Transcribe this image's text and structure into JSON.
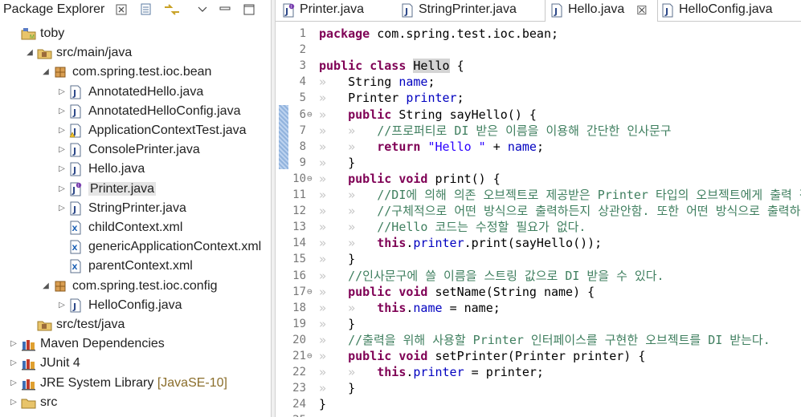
{
  "package_explorer": {
    "title": "Package Explorer",
    "header_icons": [
      "close-icon",
      "collapse-all-icon",
      "link-with-editor-icon",
      "view-menu-icon",
      "minimize-icon",
      "maximize-icon"
    ],
    "tree": [
      {
        "depth": 0,
        "twisty": "none",
        "icon": "project-icon",
        "label": "toby"
      },
      {
        "depth": 1,
        "twisty": "open",
        "icon": "source-folder-icon",
        "label": "src/main/java"
      },
      {
        "depth": 2,
        "twisty": "open",
        "icon": "package-icon",
        "label": "com.spring.test.ioc.bean"
      },
      {
        "depth": 3,
        "twisty": "closed",
        "icon": "java-file-icon",
        "label": "AnnotatedHello.java"
      },
      {
        "depth": 3,
        "twisty": "closed",
        "icon": "java-file-icon",
        "label": "AnnotatedHelloConfig.java"
      },
      {
        "depth": 3,
        "twisty": "closed",
        "icon": "java-file-warning-icon",
        "label": "ApplicationContextTest.java"
      },
      {
        "depth": 3,
        "twisty": "closed",
        "icon": "java-file-icon",
        "label": "ConsolePrinter.java"
      },
      {
        "depth": 3,
        "twisty": "closed",
        "icon": "java-file-icon",
        "label": "Hello.java"
      },
      {
        "depth": 3,
        "twisty": "closed",
        "icon": "java-interface-file-icon",
        "label": "Printer.java",
        "selected": true
      },
      {
        "depth": 3,
        "twisty": "closed",
        "icon": "java-file-icon",
        "label": "StringPrinter.java"
      },
      {
        "depth": 3,
        "twisty": "none",
        "icon": "xml-file-icon",
        "label": "childContext.xml"
      },
      {
        "depth": 3,
        "twisty": "none",
        "icon": "xml-file-icon",
        "label": "genericApplicationContext.xml"
      },
      {
        "depth": 3,
        "twisty": "none",
        "icon": "xml-file-icon",
        "label": "parentContext.xml"
      },
      {
        "depth": 2,
        "twisty": "open",
        "icon": "package-icon",
        "label": "com.spring.test.ioc.config"
      },
      {
        "depth": 3,
        "twisty": "closed",
        "icon": "java-file-icon",
        "label": "HelloConfig.java"
      },
      {
        "depth": 1,
        "twisty": "none",
        "icon": "source-folder-icon",
        "label": "src/test/java"
      },
      {
        "depth": 0,
        "twisty": "closed",
        "icon": "library-icon",
        "label": "Maven Dependencies"
      },
      {
        "depth": 0,
        "twisty": "closed",
        "icon": "library-icon",
        "label": "JUnit 4"
      },
      {
        "depth": 0,
        "twisty": "closed",
        "icon": "library-icon",
        "label": "JRE System Library",
        "decor": "[JavaSE-10]"
      },
      {
        "depth": 0,
        "twisty": "closed",
        "icon": "folder-icon",
        "label": "src"
      }
    ]
  },
  "editor": {
    "tabs": [
      {
        "label": "Printer.java",
        "icon": "java-interface-file-icon",
        "active": false
      },
      {
        "label": "StringPrinter.java",
        "icon": "java-file-icon",
        "active": false
      },
      {
        "label": "Hello.java",
        "icon": "java-file-icon",
        "active": true,
        "close": "☒"
      },
      {
        "label": "HelloConfig.java",
        "icon": "java-file-icon",
        "active": false
      }
    ],
    "lines": [
      {
        "n": "1",
        "fold": "",
        "segs": [
          [
            "kw",
            "package"
          ],
          [
            "ws",
            " "
          ],
          [
            "",
            "com.spring.test.ioc.bean;"
          ]
        ]
      },
      {
        "n": "2",
        "fold": "",
        "segs": []
      },
      {
        "n": "3",
        "fold": "",
        "segs": [
          [
            "kw",
            "public"
          ],
          [
            "ws",
            " "
          ],
          [
            "kw",
            "class"
          ],
          [
            "ws",
            " "
          ],
          [
            "hl",
            "Hello"
          ],
          [
            "ws",
            " "
          ],
          [
            "",
            "{"
          ]
        ]
      },
      {
        "n": "4",
        "fold": "",
        "segs": [
          [
            "ws",
            "»   "
          ],
          [
            "",
            "String"
          ],
          [
            "ws",
            " "
          ],
          [
            "fld",
            "name"
          ],
          [
            "",
            ";"
          ]
        ]
      },
      {
        "n": "5",
        "fold": "",
        "segs": [
          [
            "ws",
            "»   "
          ],
          [
            "",
            "Printer"
          ],
          [
            "ws",
            " "
          ],
          [
            "fld",
            "printer"
          ],
          [
            "",
            ";"
          ]
        ]
      },
      {
        "n": "6",
        "fold": "⊖",
        "segs": [
          [
            "ws",
            "»   "
          ],
          [
            "kw",
            "public"
          ],
          [
            "ws",
            " "
          ],
          [
            "",
            "String"
          ],
          [
            "ws",
            " "
          ],
          [
            "",
            "sayHello()"
          ],
          [
            "ws",
            " "
          ],
          [
            "",
            "{"
          ]
        ]
      },
      {
        "n": "7",
        "fold": "",
        "segs": [
          [
            "ws",
            "»   »   "
          ],
          [
            "cmt",
            "//프로퍼티로 DI 받은 이름을 이용해 간단한 인사문구"
          ]
        ]
      },
      {
        "n": "8",
        "fold": "",
        "segs": [
          [
            "ws",
            "»   »   "
          ],
          [
            "kw",
            "return"
          ],
          [
            "ws",
            " "
          ],
          [
            "str",
            "\"Hello \""
          ],
          [
            "ws",
            " "
          ],
          [
            "",
            "+"
          ],
          [
            "ws",
            " "
          ],
          [
            "fld",
            "name"
          ],
          [
            "",
            ";"
          ]
        ]
      },
      {
        "n": "9",
        "fold": "",
        "segs": [
          [
            "ws",
            "»   "
          ],
          [
            "",
            "}"
          ]
        ]
      },
      {
        "n": "10",
        "fold": "⊖",
        "segs": [
          [
            "ws",
            "»   "
          ],
          [
            "kw",
            "public"
          ],
          [
            "ws",
            " "
          ],
          [
            "kw",
            "void"
          ],
          [
            "ws",
            " "
          ],
          [
            "",
            "print()"
          ],
          [
            "ws",
            " "
          ],
          [
            "",
            "{"
          ]
        ]
      },
      {
        "n": "11",
        "fold": "",
        "segs": [
          [
            "ws",
            "»   »   "
          ],
          [
            "cmt",
            "//DI에 의해 의존 오브젝트로 제공받은 Printer 타입의 오브젝트에게 출력 작업을 위임."
          ]
        ]
      },
      {
        "n": "12",
        "fold": "",
        "segs": [
          [
            "ws",
            "»   »   "
          ],
          [
            "cmt",
            "//구체적으로 어떤 방식으로 출력하든지 상관안함. 또한 어떤 방식으로 출력하도록 변경해도"
          ]
        ]
      },
      {
        "n": "13",
        "fold": "",
        "segs": [
          [
            "ws",
            "»   »   "
          ],
          [
            "cmt",
            "//Hello 코드는 수정할 필요가 없다."
          ]
        ]
      },
      {
        "n": "14",
        "fold": "",
        "segs": [
          [
            "ws",
            "»   »   "
          ],
          [
            "kw",
            "this"
          ],
          [
            "",
            "."
          ],
          [
            "fld",
            "printer"
          ],
          [
            "",
            ".print(sayHello());"
          ]
        ]
      },
      {
        "n": "15",
        "fold": "",
        "segs": [
          [
            "ws",
            "»   "
          ],
          [
            "",
            "}"
          ]
        ]
      },
      {
        "n": "16",
        "fold": "",
        "segs": [
          [
            "ws",
            "»   "
          ],
          [
            "cmt",
            "//인사문구에 쓸 이름을 스트링 값으로 DI 받을 수 있다."
          ]
        ]
      },
      {
        "n": "17",
        "fold": "⊖",
        "segs": [
          [
            "ws",
            "»   "
          ],
          [
            "kw",
            "public"
          ],
          [
            "ws",
            " "
          ],
          [
            "kw",
            "void"
          ],
          [
            "ws",
            " "
          ],
          [
            "",
            "setName(String"
          ],
          [
            "ws",
            " "
          ],
          [
            "",
            "name)"
          ],
          [
            "ws",
            " "
          ],
          [
            "",
            "{"
          ]
        ]
      },
      {
        "n": "18",
        "fold": "",
        "segs": [
          [
            "ws",
            "»   »   "
          ],
          [
            "kw",
            "this"
          ],
          [
            "",
            "."
          ],
          [
            "fld",
            "name"
          ],
          [
            "ws",
            " "
          ],
          [
            "",
            "="
          ],
          [
            "ws",
            " "
          ],
          [
            "",
            "name;"
          ]
        ]
      },
      {
        "n": "19",
        "fold": "",
        "segs": [
          [
            "ws",
            "»   "
          ],
          [
            "",
            "}"
          ]
        ]
      },
      {
        "n": "20",
        "fold": "",
        "segs": [
          [
            "ws",
            "»   "
          ],
          [
            "cmt",
            "//출력을 위해 사용할 Printer 인터페이스를 구현한 오브젝트를 DI 받는다."
          ]
        ]
      },
      {
        "n": "21",
        "fold": "⊖",
        "segs": [
          [
            "ws",
            "»   "
          ],
          [
            "kw",
            "public"
          ],
          [
            "ws",
            " "
          ],
          [
            "kw",
            "void"
          ],
          [
            "ws",
            " "
          ],
          [
            "",
            "setPrinter(Printer"
          ],
          [
            "ws",
            " "
          ],
          [
            "",
            "printer)"
          ],
          [
            "ws",
            " "
          ],
          [
            "",
            "{"
          ]
        ]
      },
      {
        "n": "22",
        "fold": "",
        "segs": [
          [
            "ws",
            "»   »   "
          ],
          [
            "kw",
            "this"
          ],
          [
            "",
            "."
          ],
          [
            "fld",
            "printer"
          ],
          [
            "ws",
            " "
          ],
          [
            "",
            "="
          ],
          [
            "ws",
            " "
          ],
          [
            "",
            "printer;"
          ]
        ]
      },
      {
        "n": "23",
        "fold": "",
        "segs": [
          [
            "ws",
            "»   "
          ],
          [
            "",
            "}"
          ]
        ]
      },
      {
        "n": "24",
        "fold": "",
        "segs": [
          [
            "",
            "}"
          ]
        ]
      },
      {
        "n": "25",
        "fold": "",
        "segs": []
      }
    ]
  },
  "colors": {
    "keyword": "#7f0055",
    "field": "#0000c0",
    "string": "#2a00ff",
    "comment": "#3f7f5f",
    "whitespace": "#c6c6c6"
  }
}
